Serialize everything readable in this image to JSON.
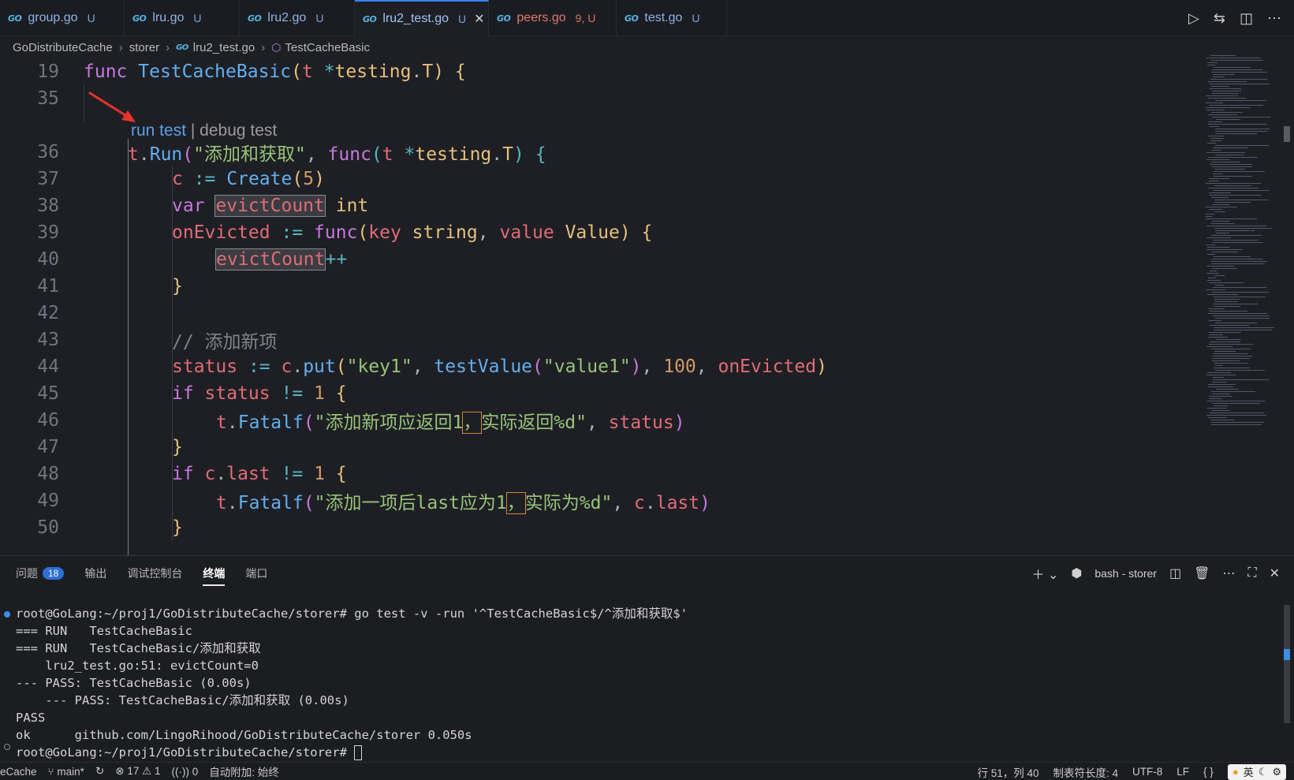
{
  "tabs": [
    {
      "label": "group.go",
      "status": "U",
      "active": false,
      "error": false
    },
    {
      "label": "lru.go",
      "status": "U",
      "active": false,
      "error": false
    },
    {
      "label": "lru2.go",
      "status": "U",
      "active": false,
      "error": false
    },
    {
      "label": "lru2_test.go",
      "status": "U",
      "active": true,
      "error": false
    },
    {
      "label": "peers.go",
      "status": "9, U",
      "active": false,
      "error": true
    },
    {
      "label": "test.go",
      "status": "U",
      "active": false,
      "error": false
    }
  ],
  "tab_close_glyph": "✕",
  "go_logo_text": "GO",
  "breadcrumb": {
    "items": [
      "GoDistributeCache",
      "storer",
      "lru2_test.go",
      "TestCacheBasic"
    ]
  },
  "codelens": {
    "run": "run test",
    "sep": " | ",
    "debug": "debug test"
  },
  "editor": {
    "lines": [
      {
        "n": "19",
        "tokens": [
          [
            "kw",
            "func "
          ],
          [
            "fn",
            "TestCacheBasic"
          ],
          [
            "br1",
            "("
          ],
          [
            "var",
            "t "
          ],
          [
            "op",
            "*"
          ],
          [
            "ty",
            "testing"
          ],
          [
            "pun",
            "."
          ],
          [
            "ty",
            "T"
          ],
          [
            "br1",
            ")"
          ],
          [
            "pun",
            " "
          ],
          [
            "br1",
            "{"
          ]
        ]
      },
      {
        "n": "35",
        "tokens": []
      },
      {
        "n": "36",
        "tokens": [
          [
            "var",
            "t"
          ],
          [
            "pun",
            "."
          ],
          [
            "fn",
            "Run"
          ],
          [
            "br2",
            "("
          ],
          [
            "str",
            "\"添加和获取\""
          ],
          [
            "pun",
            ", "
          ],
          [
            "kw",
            "func"
          ],
          [
            "br3",
            "("
          ],
          [
            "var",
            "t "
          ],
          [
            "op",
            "*"
          ],
          [
            "ty",
            "testing"
          ],
          [
            "pun",
            "."
          ],
          [
            "ty",
            "T"
          ],
          [
            "br3",
            ")"
          ],
          [
            "pun",
            " "
          ],
          [
            "br3",
            "{"
          ]
        ]
      },
      {
        "n": "37",
        "tokens": [
          [
            "var",
            "c "
          ],
          [
            "op",
            ":= "
          ],
          [
            "fn",
            "Create"
          ],
          [
            "br1",
            "("
          ],
          [
            "num",
            "5"
          ],
          [
            "br1",
            ")"
          ]
        ]
      },
      {
        "n": "38",
        "tokens": [
          [
            "kw",
            "var "
          ],
          [
            "var hl",
            "evictCount"
          ],
          [
            "pun",
            " "
          ],
          [
            "ty",
            "int"
          ]
        ]
      },
      {
        "n": "39",
        "tokens": [
          [
            "var",
            "onEvicted "
          ],
          [
            "op",
            ":= "
          ],
          [
            "kw",
            "func"
          ],
          [
            "br1",
            "("
          ],
          [
            "var",
            "key "
          ],
          [
            "ty",
            "string"
          ],
          [
            "pun",
            ", "
          ],
          [
            "var",
            "value "
          ],
          [
            "ty",
            "Value"
          ],
          [
            "br1",
            ")"
          ],
          [
            "pun",
            " "
          ],
          [
            "br1",
            "{"
          ]
        ]
      },
      {
        "n": "40",
        "tokens": [
          [
            "var hl",
            "evictCount"
          ],
          [
            "op",
            "++"
          ]
        ]
      },
      {
        "n": "41",
        "tokens": [
          [
            "br1",
            "}"
          ]
        ]
      },
      {
        "n": "42",
        "tokens": []
      },
      {
        "n": "43",
        "tokens": [
          [
            "cm",
            "// 添加新项"
          ]
        ]
      },
      {
        "n": "44",
        "tokens": [
          [
            "var",
            "status "
          ],
          [
            "op",
            ":= "
          ],
          [
            "var",
            "c"
          ],
          [
            "pun",
            "."
          ],
          [
            "fn",
            "put"
          ],
          [
            "br1",
            "("
          ],
          [
            "str",
            "\"key1\""
          ],
          [
            "pun",
            ", "
          ],
          [
            "fn",
            "testValue"
          ],
          [
            "br2",
            "("
          ],
          [
            "str",
            "\"value1\""
          ],
          [
            "br2",
            ")"
          ],
          [
            "pun",
            ", "
          ],
          [
            "num",
            "100"
          ],
          [
            "pun",
            ", "
          ],
          [
            "var",
            "onEvicted"
          ],
          [
            "br1",
            ")"
          ]
        ]
      },
      {
        "n": "45",
        "tokens": [
          [
            "kw",
            "if "
          ],
          [
            "var",
            "status "
          ],
          [
            "op",
            "!= "
          ],
          [
            "num",
            "1 "
          ],
          [
            "br1",
            "{"
          ]
        ]
      },
      {
        "n": "46",
        "tokens": [
          [
            "var",
            "t"
          ],
          [
            "pun",
            "."
          ],
          [
            "fn",
            "Fatalf"
          ],
          [
            "br2",
            "("
          ],
          [
            "str",
            "\"添加新项应返回1"
          ],
          [
            "str hlb",
            "，"
          ],
          [
            "str",
            "实际返回%d\""
          ],
          [
            "pun",
            ", "
          ],
          [
            "var",
            "status"
          ],
          [
            "br2",
            ")"
          ]
        ]
      },
      {
        "n": "47",
        "tokens": [
          [
            "br1",
            "}"
          ]
        ]
      },
      {
        "n": "48",
        "tokens": [
          [
            "kw",
            "if "
          ],
          [
            "var",
            "c"
          ],
          [
            "pun",
            "."
          ],
          [
            "var",
            "last "
          ],
          [
            "op",
            "!= "
          ],
          [
            "num",
            "1 "
          ],
          [
            "br1",
            "{"
          ]
        ]
      },
      {
        "n": "49",
        "tokens": [
          [
            "var",
            "t"
          ],
          [
            "pun",
            "."
          ],
          [
            "fn",
            "Fatalf"
          ],
          [
            "br2",
            "("
          ],
          [
            "str",
            "\"添加一项后last应为1"
          ],
          [
            "str hlb",
            "，"
          ],
          [
            "str",
            "实际为%d\""
          ],
          [
            "pun",
            ", "
          ],
          [
            "var",
            "c"
          ],
          [
            "pun",
            "."
          ],
          [
            "var",
            "last"
          ],
          [
            "br2",
            ")"
          ]
        ]
      },
      {
        "n": "50",
        "tokens": [
          [
            "br1",
            "}"
          ]
        ]
      }
    ]
  },
  "panel": {
    "tabs": [
      {
        "label": "问题",
        "badge": "18",
        "active": false
      },
      {
        "label": "输出",
        "active": false
      },
      {
        "label": "调试控制台",
        "active": false
      },
      {
        "label": "终端",
        "active": true
      },
      {
        "label": "端口",
        "active": false
      }
    ],
    "terminal_name": "bash - storer"
  },
  "terminal": {
    "lines": [
      "root@GoLang:~/proj1/GoDistributeCache/storer# go test -v -run '^TestCacheBasic$/^添加和获取$'",
      "=== RUN   TestCacheBasic",
      "=== RUN   TestCacheBasic/添加和获取",
      "    lru2_test.go:51: evictCount=0",
      "--- PASS: TestCacheBasic (0.00s)",
      "    --- PASS: TestCacheBasic/添加和获取 (0.00s)",
      "PASS",
      "ok      github.com/LingoRihood/GoDistributeCache/storer 0.050s",
      "root@GoLang:~/proj1/GoDistributeCache/storer# "
    ]
  },
  "statusbar": {
    "workspace": "eCache",
    "branch": "main*",
    "errors": "17",
    "warnings": "1",
    "ports": "0",
    "auto_attach": "自动附加: 始终",
    "position": "行 51，列 40",
    "tab_size": "制表符长度: 4",
    "encoding": "UTF-8",
    "eol": "LF",
    "lang": "{ }",
    "ime": "英"
  },
  "colors": {
    "accent": "#3b82f6",
    "badge": "#2d6fd6",
    "arrow": "#e8332c"
  }
}
